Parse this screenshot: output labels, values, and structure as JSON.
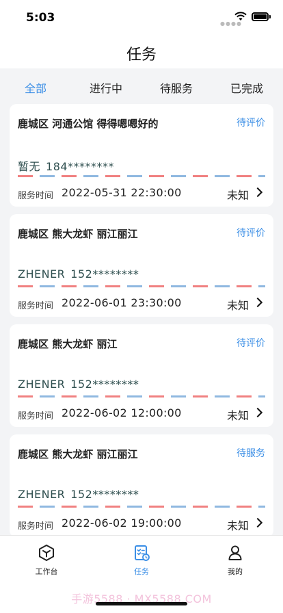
{
  "status_bar": {
    "time": "5:03"
  },
  "header": {
    "title": "任务"
  },
  "tabs": [
    {
      "label": "全部",
      "active": true
    },
    {
      "label": "进行中",
      "active": false
    },
    {
      "label": "待服务",
      "active": false
    },
    {
      "label": "已完成",
      "active": false
    }
  ],
  "time_label": "服务时间",
  "cards": [
    {
      "title": "鹿城区 河通公馆 得得嗯嗯好的",
      "status": "待评价",
      "name": "暂无",
      "phone": "184********",
      "time": "2022-05-31 22:30:00",
      "price": "未知"
    },
    {
      "title": "鹿城区 熊大龙虾 丽江丽江",
      "status": "待评价",
      "name": "ZHENER",
      "phone": "152********",
      "time": "2022-06-01 23:30:00",
      "price": "未知"
    },
    {
      "title": "鹿城区 熊大龙虾 丽江",
      "status": "待评价",
      "name": "ZHENER",
      "phone": "152********",
      "time": "2022-06-02 12:00:00",
      "price": "未知"
    },
    {
      "title": "鹿城区 熊大龙虾 丽江丽江",
      "status": "待服务",
      "name": "ZHENER",
      "phone": "152********",
      "time": "2022-06-02 19:00:00",
      "price": "未知"
    }
  ],
  "bottom_tabs": [
    {
      "label": "工作台",
      "icon": "cube-icon",
      "active": false
    },
    {
      "label": "任务",
      "icon": "task-list-icon",
      "active": true
    },
    {
      "label": "我的",
      "icon": "person-icon",
      "active": false
    }
  ],
  "watermark": "手游5588 · MX5588.COM",
  "colors": {
    "accent": "#3a8ee6",
    "stripe_red": "#f08080",
    "stripe_blue": "#8fb8e0"
  }
}
